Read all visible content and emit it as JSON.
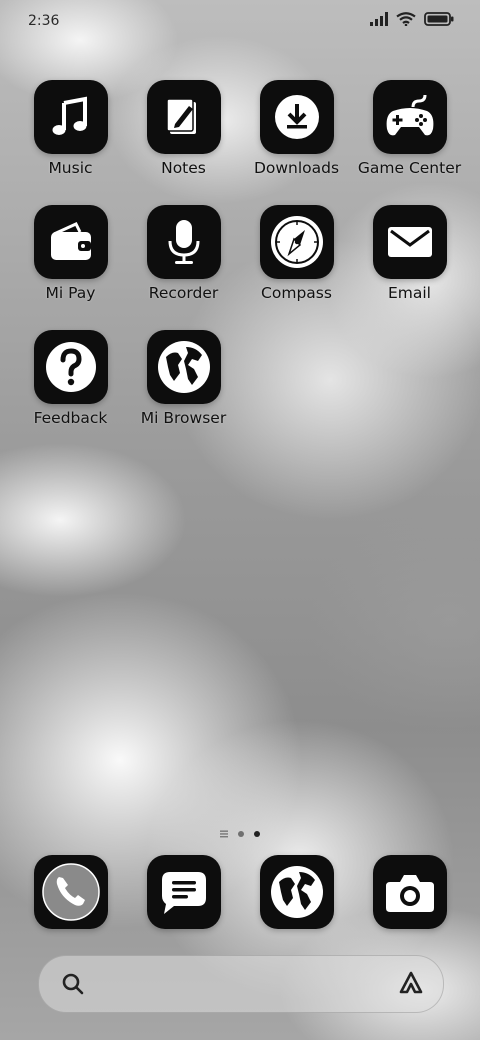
{
  "status_bar": {
    "time": "2:36"
  },
  "apps": [
    {
      "label": "Music",
      "icon": "music-note-icon"
    },
    {
      "label": "Notes",
      "icon": "notes-pencil-icon"
    },
    {
      "label": "Downloads",
      "icon": "download-icon"
    },
    {
      "label": "Game Center",
      "icon": "gamepad-icon"
    },
    {
      "label": "Mi Pay",
      "icon": "wallet-icon"
    },
    {
      "label": "Recorder",
      "icon": "microphone-icon"
    },
    {
      "label": "Compass",
      "icon": "compass-icon"
    },
    {
      "label": "Email",
      "icon": "envelope-icon"
    },
    {
      "label": "Feedback",
      "icon": "question-icon"
    },
    {
      "label": "Mi Browser",
      "icon": "globe-icon"
    }
  ],
  "page_indicator": {
    "pages": 3,
    "active": 2
  },
  "dock": [
    {
      "icon": "phone-icon"
    },
    {
      "icon": "messages-icon"
    },
    {
      "icon": "globe-icon"
    },
    {
      "icon": "camera-icon"
    }
  ],
  "colors": {
    "icon_bg": "#0d0d0d",
    "icon_fg": "#ffffff",
    "label": "#111111"
  }
}
